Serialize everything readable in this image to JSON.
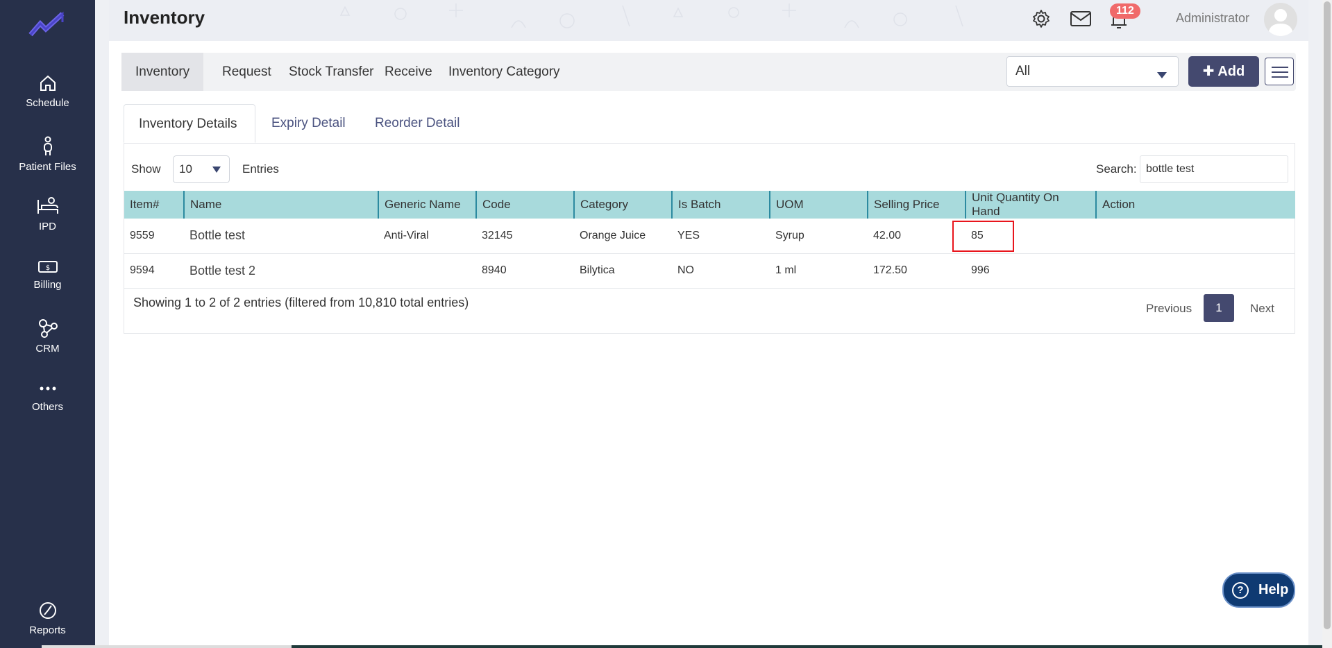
{
  "sidebar": {
    "items": [
      {
        "label": "Schedule",
        "icon": "home-icon"
      },
      {
        "label": "Patient Files",
        "icon": "person-icon"
      },
      {
        "label": "IPD",
        "icon": "bed-icon"
      },
      {
        "label": "Billing",
        "icon": "cash-icon"
      },
      {
        "label": "CRM",
        "icon": "network-icon"
      },
      {
        "label": "Others",
        "icon": "more-icon"
      },
      {
        "label": "Reports",
        "icon": "pie-icon"
      }
    ]
  },
  "header": {
    "title": "Inventory",
    "notification_count": "112",
    "user_name": "Administrator"
  },
  "nav": {
    "tabs": [
      "Inventory",
      "Request",
      "Stock Transfer",
      "Receive",
      "Inventory Category"
    ],
    "filter_value": "All",
    "add_label": "Add"
  },
  "subtabs": [
    "Inventory Details",
    "Expiry Detail",
    "Reorder Detail"
  ],
  "table_controls": {
    "show_label": "Show",
    "page_size": "10",
    "entries_label": "Entries",
    "search_label": "Search:",
    "search_value": "bottle test"
  },
  "table": {
    "columns": [
      "Item#",
      "Name",
      "Generic Name",
      "Code",
      "Category",
      "Is Batch",
      "UOM",
      "Selling Price",
      "Unit Quantity On Hand",
      "Action"
    ],
    "rows": [
      [
        "9559",
        "Bottle test",
        "Anti-Viral",
        "32145",
        "Orange Juice",
        "YES",
        "Syrup",
        "42.00",
        "85",
        ""
      ],
      [
        "9594",
        "Bottle test 2",
        "",
        "8940",
        "Bilytica",
        "NO",
        "1 ml",
        "172.50",
        "996",
        ""
      ]
    ]
  },
  "footer": {
    "info": "Showing 1 to 2 of 2 entries (filtered from 10,810 total entries)",
    "previous": "Previous",
    "page": "1",
    "next": "Next"
  },
  "help_label": "Help",
  "colors": {
    "sidebar": "#27304a",
    "accent": "#44496f",
    "table_header": "#a8dadc",
    "highlight": "#e8151c",
    "badge": "#f06a6a"
  }
}
